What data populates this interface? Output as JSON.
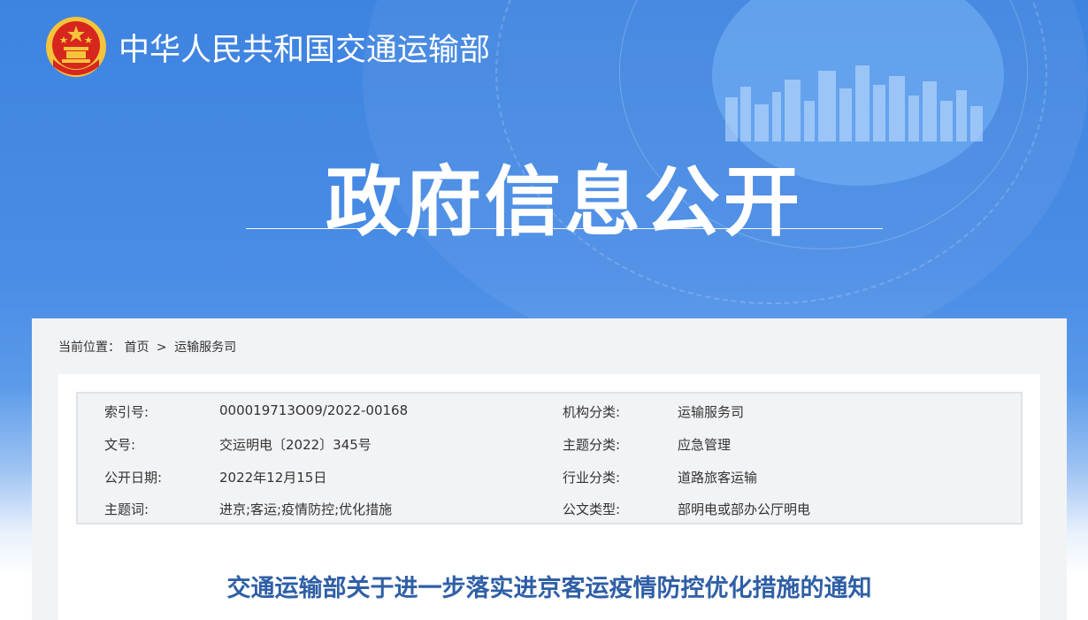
{
  "header": {
    "ministry_name": "中华人民共和国交通运输部",
    "section_title": "政府信息公开"
  },
  "breadcrumb": {
    "label": "当前位置：",
    "items": [
      "首页",
      "运输服务司"
    ],
    "separator": ">"
  },
  "metadata": {
    "rows": [
      {
        "l1": "索引号:",
        "v1": "000019713O09/2022-00168",
        "l2": "机构分类:",
        "v2": "运输服务司"
      },
      {
        "l1": "文号:",
        "v1": "交运明电〔2022〕345号",
        "l2": "主题分类:",
        "v2": "应急管理"
      },
      {
        "l1": "公开日期:",
        "v1": "2022年12月15日",
        "l2": "行业分类:",
        "v2": "道路旅客运输"
      },
      {
        "l1": "主题词:",
        "v1": "进京;客运;疫情防控;优化措施",
        "l2": "公文类型:",
        "v2": "部明电或部办公厅明电"
      }
    ]
  },
  "document": {
    "title": "交通运输部关于进一步落实进京客运疫情防控优化措施的通知"
  },
  "colors": {
    "hero_blue": "#3d83e0",
    "title_blue": "#2f5fa6",
    "panel_gray": "#f2f3f5",
    "emblem_red": "#d7261e",
    "emblem_gold": "#f5c43a"
  },
  "icons": {
    "emblem": "national-emblem-icon",
    "skyline": "city-skyline-graphic"
  }
}
